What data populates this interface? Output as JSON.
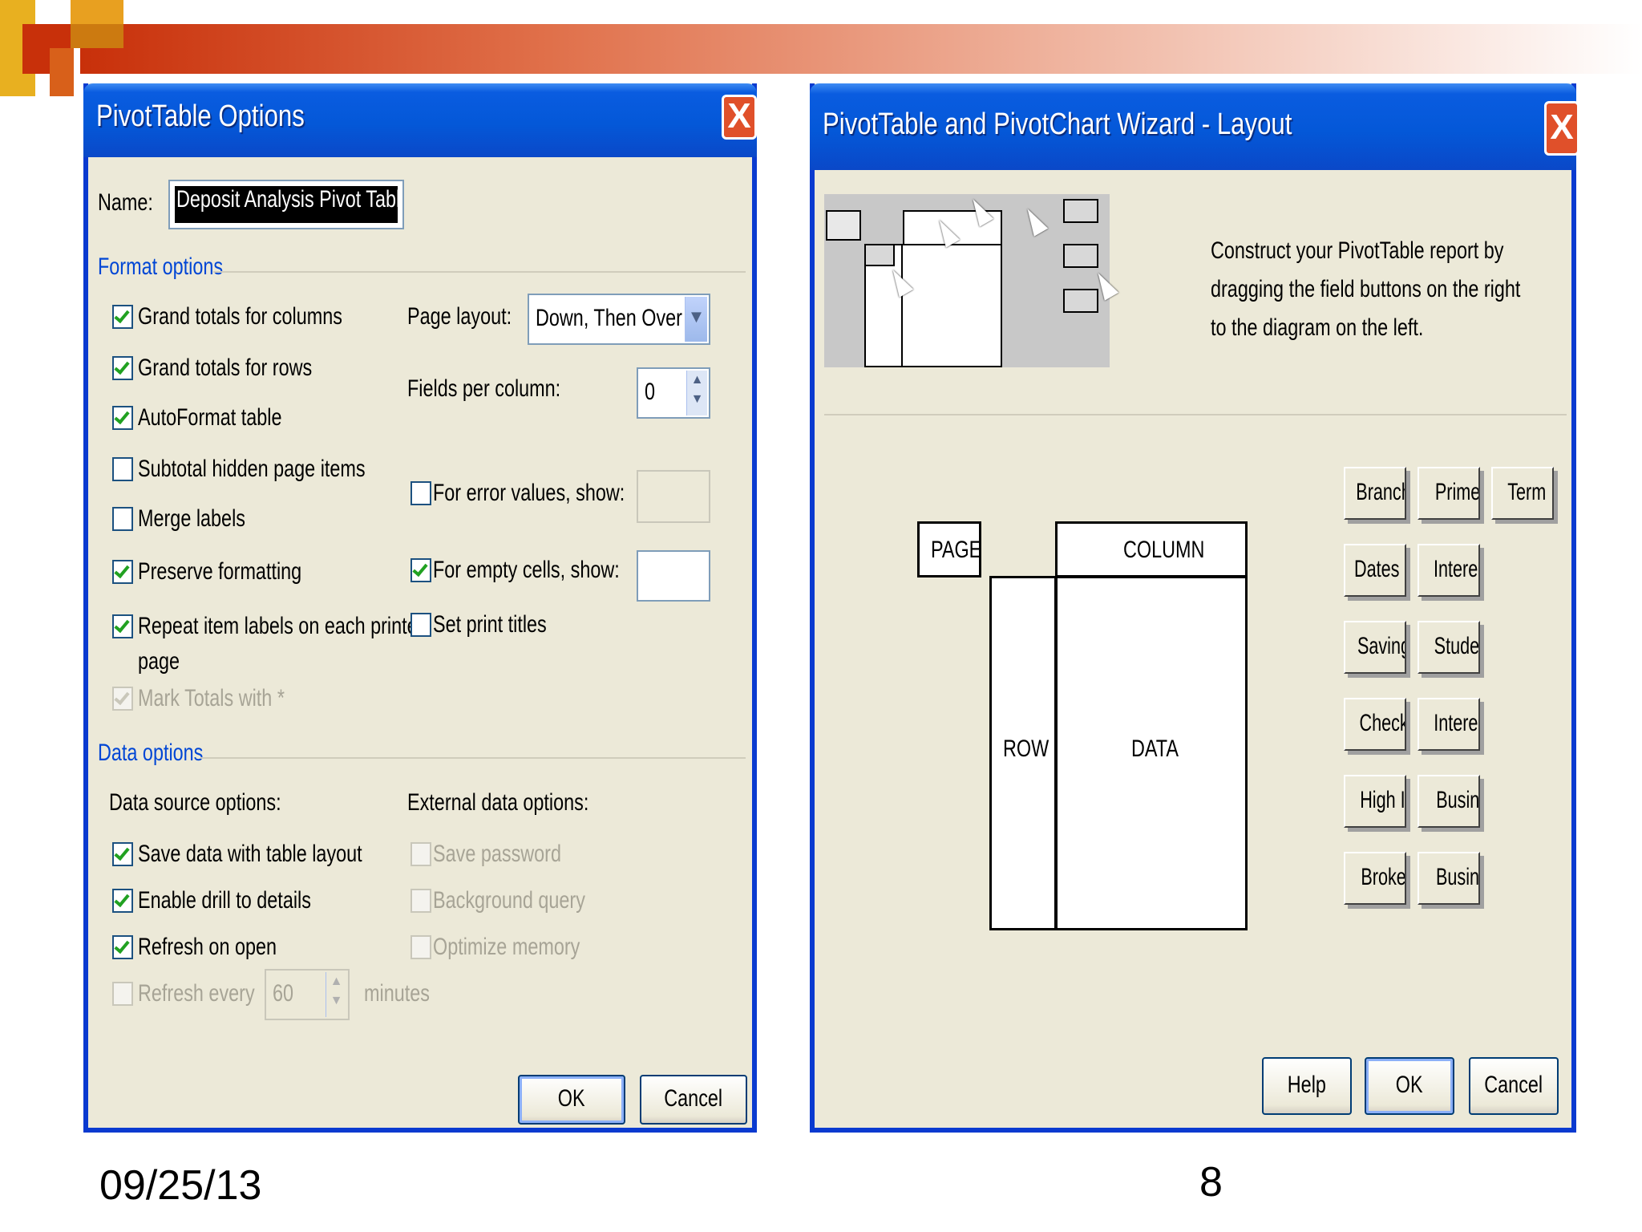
{
  "slide": {
    "date": "09/25/13",
    "page_number": "8"
  },
  "options_dialog": {
    "title": "PivotTable Options",
    "close_glyph": "X",
    "name_label": "Name:",
    "name_value": "Deposit Analysis Pivot Table",
    "format_section": "Format options",
    "format_checks": [
      {
        "label": "Grand totals for columns",
        "checked": true
      },
      {
        "label": "Grand totals for rows",
        "checked": true
      },
      {
        "label": "AutoFormat table",
        "checked": true
      },
      {
        "label": "Subtotal hidden page items",
        "checked": false
      },
      {
        "label": "Merge labels",
        "checked": false
      },
      {
        "label": "Preserve formatting",
        "checked": true
      },
      {
        "label": "Repeat item labels on each printed",
        "label2": "page",
        "checked": true
      },
      {
        "label": "Mark Totals with *",
        "checked": true,
        "disabled": true
      }
    ],
    "page_layout_label": "Page layout:",
    "page_layout_value": "Down, Then Over",
    "fields_per_column_label": "Fields per column:",
    "fields_per_column_value": "0",
    "error_values_label": "For error values, show:",
    "empty_cells_label": "For empty cells, show:",
    "print_titles_label": "Set print titles",
    "data_section": "Data options",
    "data_source_label": "Data source options:",
    "data_source_checks": [
      {
        "label": "Save data with table layout",
        "checked": true
      },
      {
        "label": "Enable drill to details",
        "checked": true
      },
      {
        "label": "Refresh on open",
        "checked": true
      }
    ],
    "refresh_every_label": "Refresh every",
    "refresh_every_value": "60",
    "minutes_label": "minutes",
    "external_label": "External data options:",
    "external_checks": [
      {
        "label": "Save password"
      },
      {
        "label": "Background query"
      },
      {
        "label": "Optimize memory"
      }
    ],
    "ok_label": "OK",
    "cancel_label": "Cancel"
  },
  "wizard_dialog": {
    "title": "PivotTable and PivotChart Wizard - Layout",
    "close_glyph": "X",
    "instructions": [
      "Construct your PivotTable report by",
      "dragging the field buttons on the right",
      "to the diagram on the left."
    ],
    "areas": {
      "page": "PAGE",
      "column": "COLUMN",
      "row": "ROW",
      "data": "DATA"
    },
    "field_buttons": [
      "Branch",
      "Prime Che",
      "Term Dep",
      "Dates",
      "Interest S",
      "Savings",
      "Student C",
      "Checking",
      "Interest C",
      "High Inter",
      "Business C",
      "Brokerage",
      "Business S"
    ],
    "help_label": "Help",
    "ok_label": "OK",
    "cancel_label": "Cancel"
  }
}
